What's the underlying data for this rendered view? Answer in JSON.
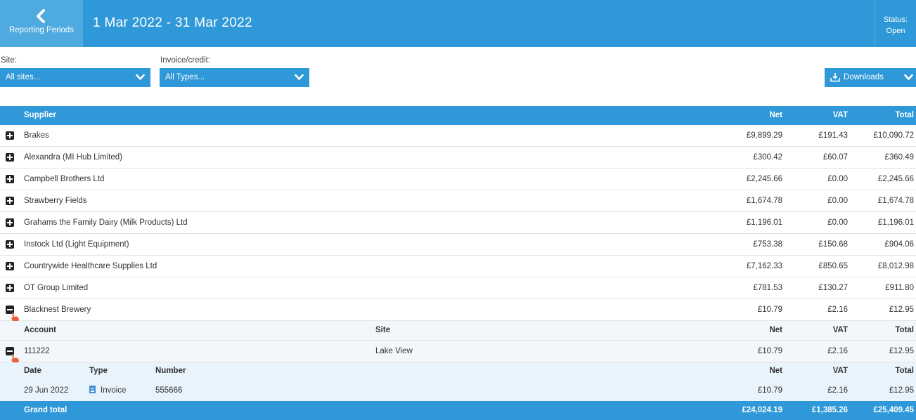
{
  "header": {
    "back_label": "Reporting Periods",
    "period": "1 Mar 2022 - 31 Mar 2022",
    "status_label": "Status:",
    "status_value": "Open"
  },
  "filters": {
    "site_label": "Site:",
    "site_value": "All sites...",
    "type_label": "Invoice/credit:",
    "type_value": "All Types...",
    "downloads_label": "Downloads"
  },
  "table": {
    "headers": {
      "supplier": "Supplier",
      "net": "Net",
      "vat": "VAT",
      "total": "Total"
    },
    "rows": [
      {
        "supplier": "Brakes",
        "net": "£9,899.29",
        "vat": "£191.43",
        "total": "£10,090.72"
      },
      {
        "supplier": "Alexandra (MI Hub Limited)",
        "net": "£300.42",
        "vat": "£60.07",
        "total": "£360.49"
      },
      {
        "supplier": "Campbell Brothers Ltd",
        "net": "£2,245.66",
        "vat": "£0.00",
        "total": "£2,245.66"
      },
      {
        "supplier": "Strawberry Fields",
        "net": "£1,674.78",
        "vat": "£0.00",
        "total": "£1,674.78"
      },
      {
        "supplier": "Grahams the Family Dairy (Milk Products) Ltd",
        "net": "£1,196.01",
        "vat": "£0.00",
        "total": "£1,196.01"
      },
      {
        "supplier": "Instock Ltd (Light Equipment)",
        "net": "£753.38",
        "vat": "£150.68",
        "total": "£904.06"
      },
      {
        "supplier": "Countrywide Healthcare Supplies Ltd",
        "net": "£7,162.33",
        "vat": "£850.65",
        "total": "£8,012.98"
      },
      {
        "supplier": "OT Group Limited",
        "net": "£781.53",
        "vat": "£130.27",
        "total": "£911.80"
      },
      {
        "supplier": "Blacknest Brewery",
        "net": "£10.79",
        "vat": "£2.16",
        "total": "£12.95"
      }
    ],
    "account_headers": {
      "account": "Account",
      "site": "Site",
      "net": "Net",
      "vat": "VAT",
      "total": "Total"
    },
    "account_row": {
      "account": "111222",
      "site": "Lake View",
      "net": "£10.79",
      "vat": "£2.16",
      "total": "£12.95"
    },
    "invoice_headers": {
      "date": "Date",
      "type": "Type",
      "number": "Number",
      "net": "Net",
      "vat": "VAT",
      "total": "Total"
    },
    "invoice_row": {
      "date": "29 Jun 2022",
      "type": "Invoice",
      "number": "555666",
      "net": "£10.79",
      "vat": "£2.16",
      "total": "£12.95"
    },
    "grand_total": {
      "label": "Grand total",
      "net": "£24,024.19",
      "vat": "£1,385.26",
      "total": "£25,409.45"
    }
  },
  "colors": {
    "accent": "#2e98d8",
    "back_panel": "#4eaadf",
    "pointer": "#e8603c"
  },
  "icons": [
    "chevron-left-icon",
    "chevron-down-icon",
    "download-icon",
    "expand-plus-icon",
    "collapse-minus-icon",
    "hand-pointer-icon",
    "document-icon"
  ]
}
